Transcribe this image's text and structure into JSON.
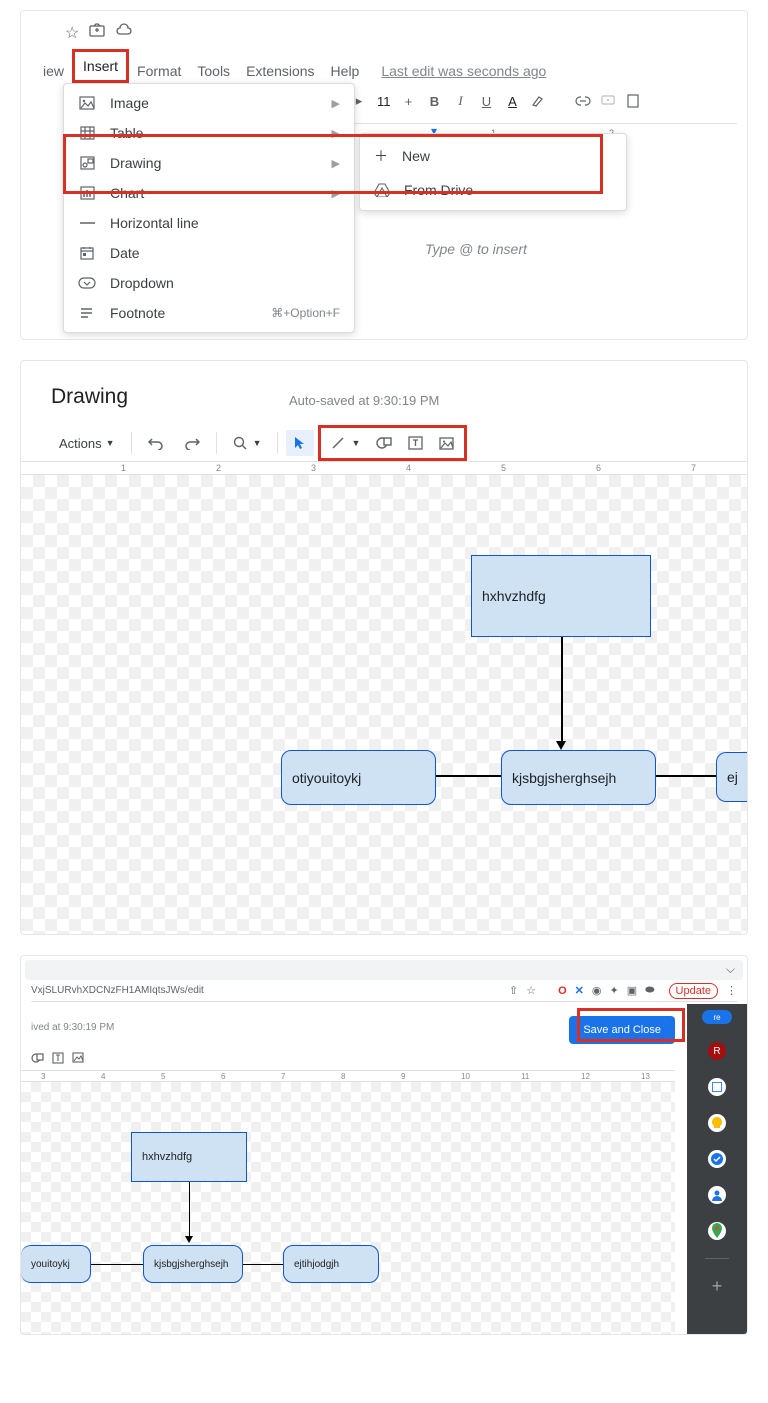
{
  "panel1": {
    "menus": {
      "view": "iew",
      "insert": "Insert",
      "format": "Format",
      "tools": "Tools",
      "extensions": "Extensions",
      "help": "Help"
    },
    "last_edit": "Last edit was seconds ago",
    "toolbar": {
      "font_size": "11",
      "plus": "+"
    },
    "placeholder": "Type @ to insert",
    "insert_items": [
      {
        "icon": "image",
        "label": "Image",
        "sub": true
      },
      {
        "icon": "table",
        "label": "Table",
        "sub": true
      },
      {
        "icon": "drawing",
        "label": "Drawing",
        "sub": true
      },
      {
        "icon": "chart",
        "label": "Chart",
        "sub": true
      },
      {
        "icon": "hr",
        "label": "Horizontal line",
        "sub": false
      },
      {
        "icon": "date",
        "label": "Date",
        "sub": false
      },
      {
        "icon": "dropdown",
        "label": "Dropdown",
        "sub": false
      },
      {
        "icon": "footnote",
        "label": "Footnote",
        "sub": false,
        "shortcut": "⌘+Option+F"
      }
    ],
    "submenu": {
      "new": "New",
      "from_drive": "From Drive"
    },
    "ruler_marks": [
      "1",
      "2"
    ]
  },
  "panel2": {
    "title": "Drawing",
    "autosave": "Auto-saved at 9:30:19 PM",
    "actions": "Actions",
    "ruler": [
      "1",
      "2",
      "3",
      "4",
      "5",
      "6",
      "7"
    ],
    "shapes": {
      "top": "hxhvzhdfg",
      "left": "otiyouitoykj",
      "mid": "kjsbgjsherghsejh",
      "right": "ej"
    }
  },
  "panel3": {
    "url": "VxjSLURvhXDCNzFH1AMIqtsJWs/edit",
    "update_label": "Update",
    "saved": "ived at 9:30:19 PM",
    "save_close": "Save and Close",
    "share_suffix": "re",
    "ruler": [
      "3",
      "4",
      "5",
      "6",
      "7",
      "8",
      "9",
      "10",
      "11",
      "12",
      "13"
    ],
    "shapes": {
      "top": "hxhvzhdfg",
      "left": "youitoykj",
      "mid": "kjsbgjsherghsejh",
      "right": "ejtihjodgjh"
    }
  }
}
